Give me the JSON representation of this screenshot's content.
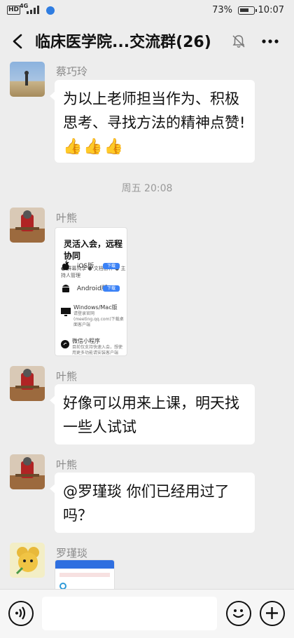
{
  "status_bar": {
    "hd": "HD",
    "network": "4G",
    "battery_percent": "73%",
    "battery_level": 0.73,
    "time": "10:07"
  },
  "header": {
    "title": "临床医学院...交流群(26)"
  },
  "messages": [
    {
      "sender": "蔡巧玲",
      "text": "为以上老师担当作为、积极思考、寻找方法的精神点赞!",
      "emoji": "👍👍👍"
    },
    {
      "timestamp": "周五 20:08"
    },
    {
      "sender": "叶熊",
      "card": {
        "title": "灵活入会，远程协同",
        "features": "● 屏幕共享  ● 文档协作  ● 主持人管理",
        "ios_label": "iOS版",
        "android_label": "Android版",
        "download": "下载",
        "pc_label": "Windows/Mac版",
        "pc_desc": "请登录官网 (meeting.qq.com)下载桌面客户端",
        "mini_label": "微信小程序",
        "mini_desc": "目前仅支持快速入会，想使用更多功能请安装客户端"
      }
    },
    {
      "sender": "叶熊",
      "text": "好像可以用来上课，明天找一些人试试"
    },
    {
      "sender": "叶熊",
      "text": "@罗瑾琰  你们已经用过了吗？"
    },
    {
      "sender": "罗瑾琰"
    }
  ]
}
